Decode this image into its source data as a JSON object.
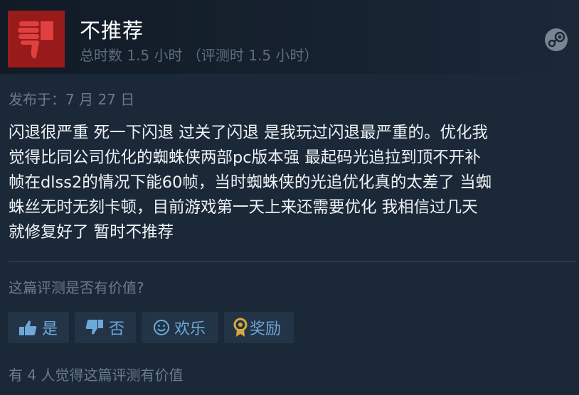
{
  "review": {
    "title": "不推荐",
    "hours": "总时数 1.5 小时 （评测时 1.5 小时）",
    "posted": "发布于：7 月 27 日",
    "lines": [
      "闪退很严重 死一下闪退 过关了闪退 是我玩过闪退最严重的。优化我",
      "觉得比同公司优化的蜘蛛侠两部pc版本强 最起码光追拉到顶不开补",
      "帧在dlss2的情况下能60帧，当时蜘蛛侠的光追优化真的太差了 当蜘",
      "蛛丝无时无刻卡顿，目前游戏第一天上来还需要优化 我相信过几天",
      "就修复好了 暂时不推荐"
    ]
  },
  "feedback": {
    "question": "这篇评测是否有价值?",
    "buttons": {
      "yes": "是",
      "no": "否",
      "funny": "欢乐",
      "award": "奖励"
    },
    "helpful_count": "有 4 人觉得这篇评测有价值"
  },
  "icons": {
    "rating": "thumbs-down-icon",
    "platform": "steam-logo-icon",
    "yes": "thumbs-up-icon",
    "no": "thumbs-down-icon",
    "funny": "smiley-icon",
    "award": "award-medal-icon"
  },
  "colors": {
    "background": "#1b2838",
    "not_recommended": "#991a1a",
    "button_bg": "#233447",
    "button_text": "#6ea8d8",
    "award_gold": "#d8a93c"
  }
}
